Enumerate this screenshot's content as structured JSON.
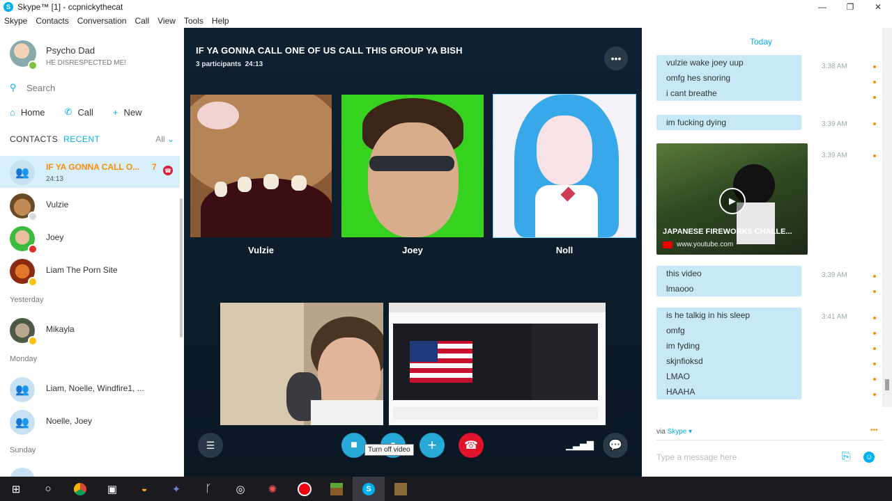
{
  "window": {
    "title": "Skype™ [1] - ccpnickythecat",
    "minimize": "—",
    "maximize": "❐",
    "close": "✕"
  },
  "menu": [
    "Skype",
    "Contacts",
    "Conversation",
    "Call",
    "View",
    "Tools",
    "Help"
  ],
  "profile": {
    "name": "Psycho Dad",
    "mood": "HE DISRESPECTED ME!"
  },
  "search": {
    "placeholder": "Search"
  },
  "nav": {
    "home": "Home",
    "call": "Call",
    "new": "New"
  },
  "tabs": {
    "contacts": "CONTACTS",
    "recent": "RECENT",
    "filter": "All"
  },
  "contacts": [
    {
      "name": "IF YA GONNA CALL O...",
      "sub": "24:13",
      "count": "7"
    },
    {
      "name": "Vulzie"
    },
    {
      "name": "Joey"
    },
    {
      "name": "Liam The Porn Site"
    },
    {
      "name": "Mikayla"
    },
    {
      "name": "Liam, Noelle, Windfire1, ..."
    },
    {
      "name": "Noelle, Joey"
    }
  ],
  "sections": {
    "yesterday": "Yesterday",
    "monday": "Monday",
    "sunday": "Sunday"
  },
  "call": {
    "title": "IF YA GONNA CALL ONE OF US CALL THIS GROUP YA BISH",
    "participants": "3 participants",
    "duration": "24:13",
    "more": "•••",
    "tiles": [
      {
        "label": "Vulzie"
      },
      {
        "label": "Joey"
      },
      {
        "label": "Noll"
      }
    ],
    "tooltip": "Turn off video"
  },
  "chat": {
    "today": "Today",
    "groups": [
      {
        "lines": [
          "vulzie wake joey uup",
          "omfg hes snoring",
          "i cant breathe"
        ],
        "time": "3:38 AM"
      },
      {
        "lines": [
          "im fucking dying"
        ],
        "time": "3:39 AM"
      },
      {
        "lines": [
          "this video",
          "lmaooo"
        ],
        "time": "3:39 AM"
      },
      {
        "lines": [
          "is he talkig in his sleep",
          "omfg",
          "im fyding",
          "skjnfioksd",
          "LMAO",
          "HAAHA"
        ],
        "time": "3:41 AM"
      }
    ],
    "video": {
      "time": "3:39 AM",
      "title": "JAPANESE FIREWORKS CHALLE...",
      "source": "www.youtube.com"
    },
    "via": "via",
    "via_app": "Skype ▾",
    "via_more": "•••",
    "composer_placeholder": "Type a message here"
  }
}
